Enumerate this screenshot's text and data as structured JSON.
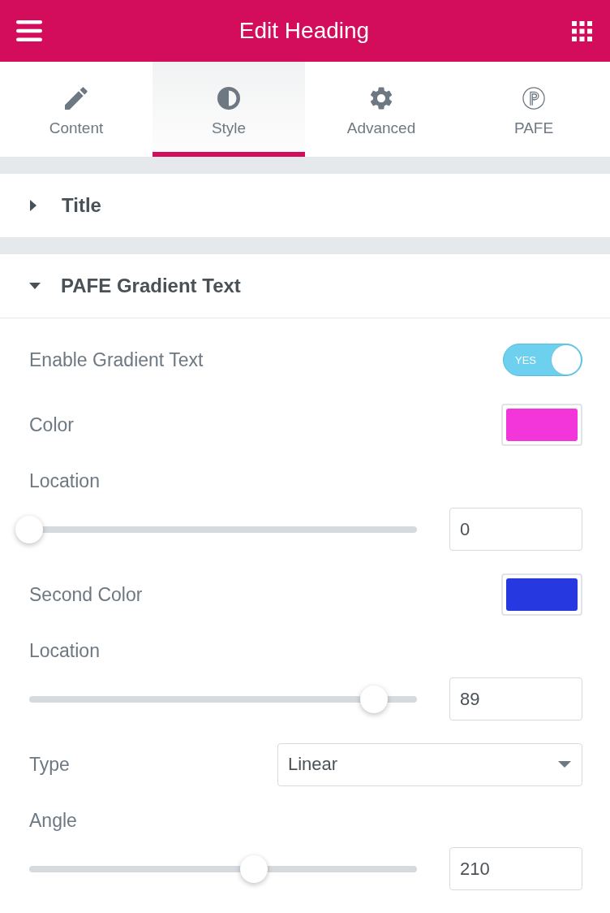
{
  "header": {
    "title": "Edit Heading"
  },
  "tabs": [
    {
      "label": "Content",
      "selected": false
    },
    {
      "label": "Style",
      "selected": true
    },
    {
      "label": "Advanced",
      "selected": false
    },
    {
      "label": "PAFE",
      "selected": false
    }
  ],
  "sections": [
    {
      "title": "Title",
      "expanded": false
    },
    {
      "title": "PAFE Gradient Text",
      "expanded": true,
      "controls": [
        {
          "kind": "switch",
          "label": "Enable Gradient Text",
          "on": true,
          "state_label": "YES"
        },
        {
          "kind": "color",
          "label": "Color",
          "color": "#f236da"
        },
        {
          "kind": "slider",
          "label": "Location",
          "level": 0,
          "value": "0"
        },
        {
          "kind": "color",
          "label": "Second Color",
          "color": "#2639e1"
        },
        {
          "kind": "slider",
          "label": "Location",
          "level": 0.89,
          "value": "89"
        },
        {
          "kind": "select",
          "label": "Type",
          "value": "Linear"
        },
        {
          "kind": "slider",
          "label": "Angle",
          "level": 0.58,
          "value": "210"
        }
      ]
    }
  ]
}
